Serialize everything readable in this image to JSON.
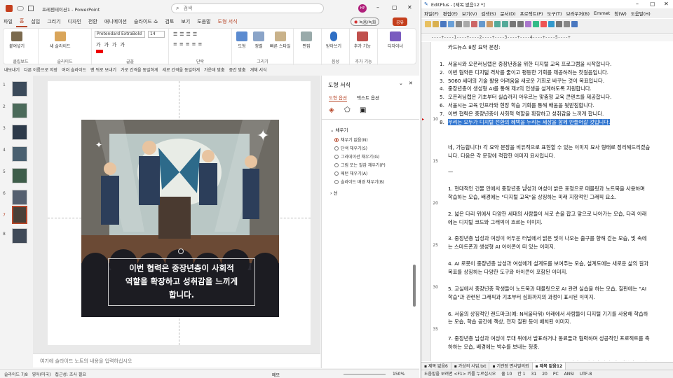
{
  "ppt": {
    "file_name": "프레젠테이션1 - PowerPoint",
    "search_placeholder": "검색",
    "user_initials": "HP",
    "record_label": "녹음/녹화",
    "share_label": "공유",
    "tabs": [
      "파일",
      "홈",
      "삽입",
      "그리기",
      "디자인",
      "전환",
      "애니메이션",
      "슬라이드 쇼",
      "검토",
      "보기",
      "도움말",
      "도형 서식"
    ],
    "ribbon": {
      "paste": "붙여넣기",
      "clipboard": "클립보드",
      "new_slide": "새 슬라이드",
      "slides": "슬라이드",
      "font_name": "Pretendard ExtraBold",
      "font_size": "14",
      "font": "글꼴",
      "paragraph": "단락",
      "shape": "도형",
      "arrange": "정렬",
      "quick_styles": "빠른 스타일",
      "drawing": "그리기",
      "edit": "편집",
      "dictate": "받아쓰기",
      "voice": "음성",
      "addin": "추가 기능",
      "addins": "추가 기능",
      "designer": "디자이너"
    },
    "subbar": [
      "내보내기",
      "다른 이름으로 저장",
      "여러 슬라이드",
      "맨 뒤로 보내기",
      "가로 간격을 동일하게",
      "세로 간격을 동일하게",
      "가운데 맞춤",
      "중간 맞춤",
      "개체 서식"
    ],
    "thumb_numbers": [
      "1",
      "2",
      "3",
      "4",
      "5",
      "6",
      "7",
      "8"
    ],
    "caption": [
      "이번 협력은 중장년층이 사회적",
      "역할을 확장하고 성취감을 느끼게",
      "합니다."
    ],
    "notes_placeholder": "여기에 슬라이드 노트의 내용을 입력하십시오",
    "status": {
      "slide": "슬라이드 7/8",
      "language": "영어(미국)",
      "accessibility": "접근성: 조사 필요",
      "notes": "메모",
      "zoom": "150%"
    },
    "pane": {
      "title": "도형 서식",
      "tab1": "도형 옵션",
      "tab2": "텍스트 옵션",
      "fill": "채우기",
      "options": [
        "채우기 없음(N)",
        "단색 채우기(S)",
        "그라데이션 채우기(G)",
        "그림 또는 질감 채우기(P)",
        "패턴 채우기(A)",
        "슬라이드 배경 채우기(B)"
      ],
      "line": "선"
    }
  },
  "ep": {
    "title": "EditPlus - [제목 없음12 *]",
    "menu": [
      "파일(F)",
      "편집(E)",
      "보기(V)",
      "검색(S)",
      "문서(D)",
      "프로젝트(P)",
      "도구(T)",
      "브라우저(B)",
      "Emmet",
      "창(W)",
      "도움말(H)"
    ],
    "ruler": "----+----1----+----2----+----3----+----4----+----5----+",
    "lines": [
      {
        "n": "",
        "t": "카드뉴스 8장 요약 문장:"
      },
      {
        "n": "",
        "t": ""
      },
      {
        "n": "1.",
        "t": "서울시와 오픈러닝랩은 중장년층을 위한 디지털 교육 프로그램을 시작합니다."
      },
      {
        "n": "2.",
        "t": "이번 협약은 디지털 격차를 줄이고 평등한 기회를 제공하려는 첫걸음입니다."
      },
      {
        "n": "3.",
        "t": "5060 세대의 기술 활용 어려움을 새로운 기회로 바꾸는 것이 목표입니다."
      },
      {
        "n": "4.",
        "t": "중장년층이 생성형 AI를 통해 제2의 인생을 설계하도록 지원합니다."
      },
      {
        "n": "5.",
        "t": "오픈러닝랩은 기초부터 실습까지 아우르는 맞춤형 교육 콘텐츠를 제공합니다."
      },
      {
        "n": "6.",
        "t": "서울시는 교육 인프라와 현장 학습 기회를 통해 배움을 뒷받침합니다."
      },
      {
        "n": "7.",
        "t": "이번 협력은 중장년층이 사회적 역할을 확장하고 성취감을 느끼게 합니다."
      },
      {
        "n": "8.",
        "t": "우리는 모두가 디지털 전환의 혜택을 누리는 세상을 함께 만들어갈 것입니다.",
        "hl": true
      },
      {
        "n": "",
        "t": ""
      },
      {
        "n": "",
        "t": ""
      },
      {
        "n": "",
        "t": "네, 가능합니다! 각 요약 문장을 비유적으로 표현할 수 있는 이미지 묘사 형태로 정리해드리겠습"
      },
      {
        "n": "",
        "t": "니다. 다음은 각 문장에 적합한 이미지 묘사입니다."
      },
      {
        "n": "",
        "t": ""
      },
      {
        "n": "",
        "t": "—"
      },
      {
        "n": "",
        "t": ""
      },
      {
        "n": "",
        "t": "1. 현대적인 건물 안에서 중장년층 남성과 여성이 밝은 표정으로 태블릿과 노트북을 사용하며"
      },
      {
        "n": "",
        "t": "학습하는 모습, 배경에는 \"디지털 교육\"을 상징하는 미래 지향적인 그래픽 요소."
      },
      {
        "n": "",
        "t": ""
      },
      {
        "n": "",
        "t": "2. 넓은 다리 위에서 다양한 세대의 사람들이 서로 손을 잡고 앞으로 나아가는 모습, 다리 아래"
      },
      {
        "n": "",
        "t": "에는 디지털 코드와 그래픽이 흐르는 이미지."
      },
      {
        "n": "",
        "t": ""
      },
      {
        "n": "",
        "t": "3. 중장년층 남성과 여성이 어두운 터널에서 밝은 빛이 나오는 출구를 향해 걷는 모습, 빛 속에"
      },
      {
        "n": "",
        "t": "는 스마트폰과 생성형 AI 아이콘이 떠 있는 이미지."
      },
      {
        "n": "",
        "t": ""
      },
      {
        "n": "",
        "t": "4. AI 로봇이 중장년층 남성과 여성에게 설계도를 보여주는 모습, 설계도에는 새로운 삶의 길과"
      },
      {
        "n": "",
        "t": "목표를 상징하는 다양한 도구와 아이콘이 포함된 이미지."
      },
      {
        "n": "",
        "t": ""
      },
      {
        "n": "",
        "t": "5. 교실에서 중장년층 학생들이 노트북과 태블릿으로 AI 관련 실습을 하는 모습, 칠판에는 \"AI"
      },
      {
        "n": "",
        "t": "학습\"과 관련된 그래픽과 기초부터 심화까지의 과정이 표시된 이미지."
      },
      {
        "n": "",
        "t": ""
      },
      {
        "n": "",
        "t": "6. 서울의 상징적인 랜드마크(예: N서울타워) 아래에서 사람들이 디지털 기기를 사용해 학습하"
      },
      {
        "n": "",
        "t": "는 모습, 학습 공간에 책상, 전자 칠판 등이 배치된 이미지."
      },
      {
        "n": "",
        "t": ""
      },
      {
        "n": "",
        "t": "7. 중장년층 남성과 여성이 무대 위에서 발표하거나 동료들과 협력하며 성공적인 프로젝트를 축"
      },
      {
        "n": "",
        "t": "하하는 모습, 배경에는 박수를 보내는 청중."
      },
      {
        "n": "",
        "t": ""
      },
      {
        "n": "",
        "t": "8. 푸른 지구를 중심으로 다양한 연령대의 사람들이 손을 맞잡고 디지털 기기(예: 태블릿, 스마"
      },
      {
        "n": "",
        "t": "트폰)를 들고 있는 모습, 지구 주위에는 디지털 네트워크 그래픽이 연결된 이미지."
      }
    ],
    "file_tabs": [
      "제목 없음6",
      "가상의 사업.txt",
      "기관장 면사말의뢰",
      "제목 없음12"
    ],
    "status": [
      "도움말을 보려면 <F1> 키를 누르십시오",
      "줄 10",
      "칸 1",
      "31",
      "20",
      "PC",
      "ANSI",
      "UTF-8"
    ]
  }
}
